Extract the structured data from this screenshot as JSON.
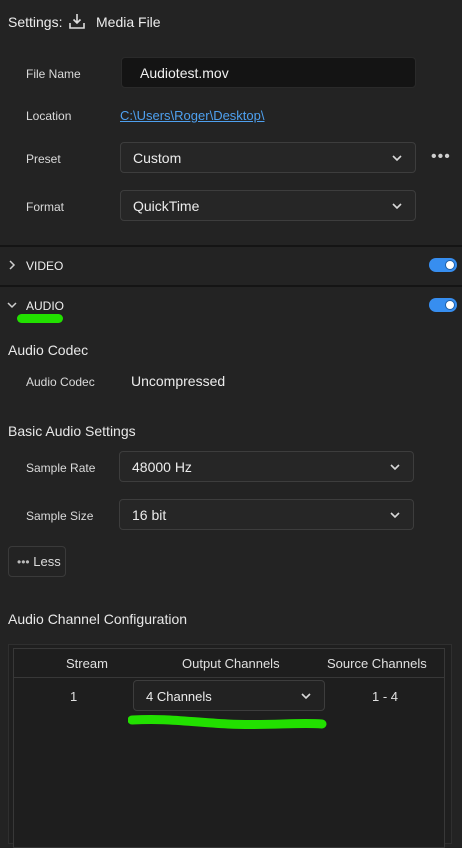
{
  "header": {
    "settings_label": "Settings:",
    "file_label": "Media File",
    "file_icon": "download-icon"
  },
  "general": {
    "file_name": {
      "label": "File Name",
      "value": "Audiotest.mov"
    },
    "location": {
      "label": "Location",
      "value": "C:\\Users\\Roger\\Desktop\\"
    },
    "preset": {
      "label": "Preset",
      "value": "Custom",
      "more": "•••"
    },
    "format": {
      "label": "Format",
      "value": "QuickTime"
    }
  },
  "sections": {
    "video": {
      "label": "VIDEO",
      "enabled": true
    },
    "audio": {
      "label": "AUDIO",
      "enabled": true
    }
  },
  "audio_codec": {
    "title": "Audio Codec",
    "label": "Audio Codec",
    "value": "Uncompressed"
  },
  "basic_audio": {
    "title": "Basic Audio Settings",
    "sample_rate": {
      "label": "Sample Rate",
      "value": "48000 Hz"
    },
    "sample_size": {
      "label": "Sample Size",
      "value": "16 bit"
    },
    "less_button": {
      "dots": "•••",
      "label": "Less"
    }
  },
  "channel_config": {
    "title": "Audio Channel Configuration",
    "columns": [
      "Stream",
      "Output Channels",
      "Source Channels"
    ],
    "rows": [
      {
        "stream": "1",
        "output": "4 Channels",
        "source": "1 - 4"
      }
    ]
  },
  "colors": {
    "accent": "#378ef0",
    "highlight": "#22e000",
    "link": "#4ea0ef"
  }
}
